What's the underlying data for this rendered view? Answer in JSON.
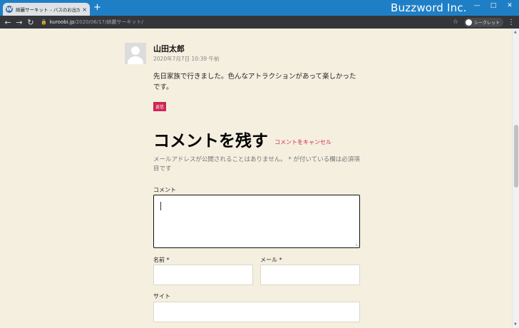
{
  "browser": {
    "tab_title": "綺麗サーキット – バスのお出かけブログ",
    "tab_close": "×",
    "new_tab": "+",
    "brand": "Buzzword Inc.",
    "url_domain": "kuroobi.jp",
    "url_path": "/2020/06/17/綺麗サーキット/",
    "incognito_label": "シークレット"
  },
  "comment": {
    "author": "山田太郎",
    "date": "2020年7月7日 10:39 午前",
    "text": "先日家族で行きました。色んなアトラクションがあって楽しかったです。",
    "reply_label": "返信"
  },
  "respond": {
    "title": "コメントを残す",
    "cancel_label": "コメントをキャンセル",
    "notes": "メールアドレスが公開されることはありません。 * が付いている欄は必須項目です",
    "comment_label": "コメント",
    "name_label": "名前 *",
    "email_label": "メール *",
    "site_label": "サイト"
  },
  "colors": {
    "accent": "#cd2653",
    "background": "#f5efe0",
    "titlebar": "#1f7fc6"
  }
}
